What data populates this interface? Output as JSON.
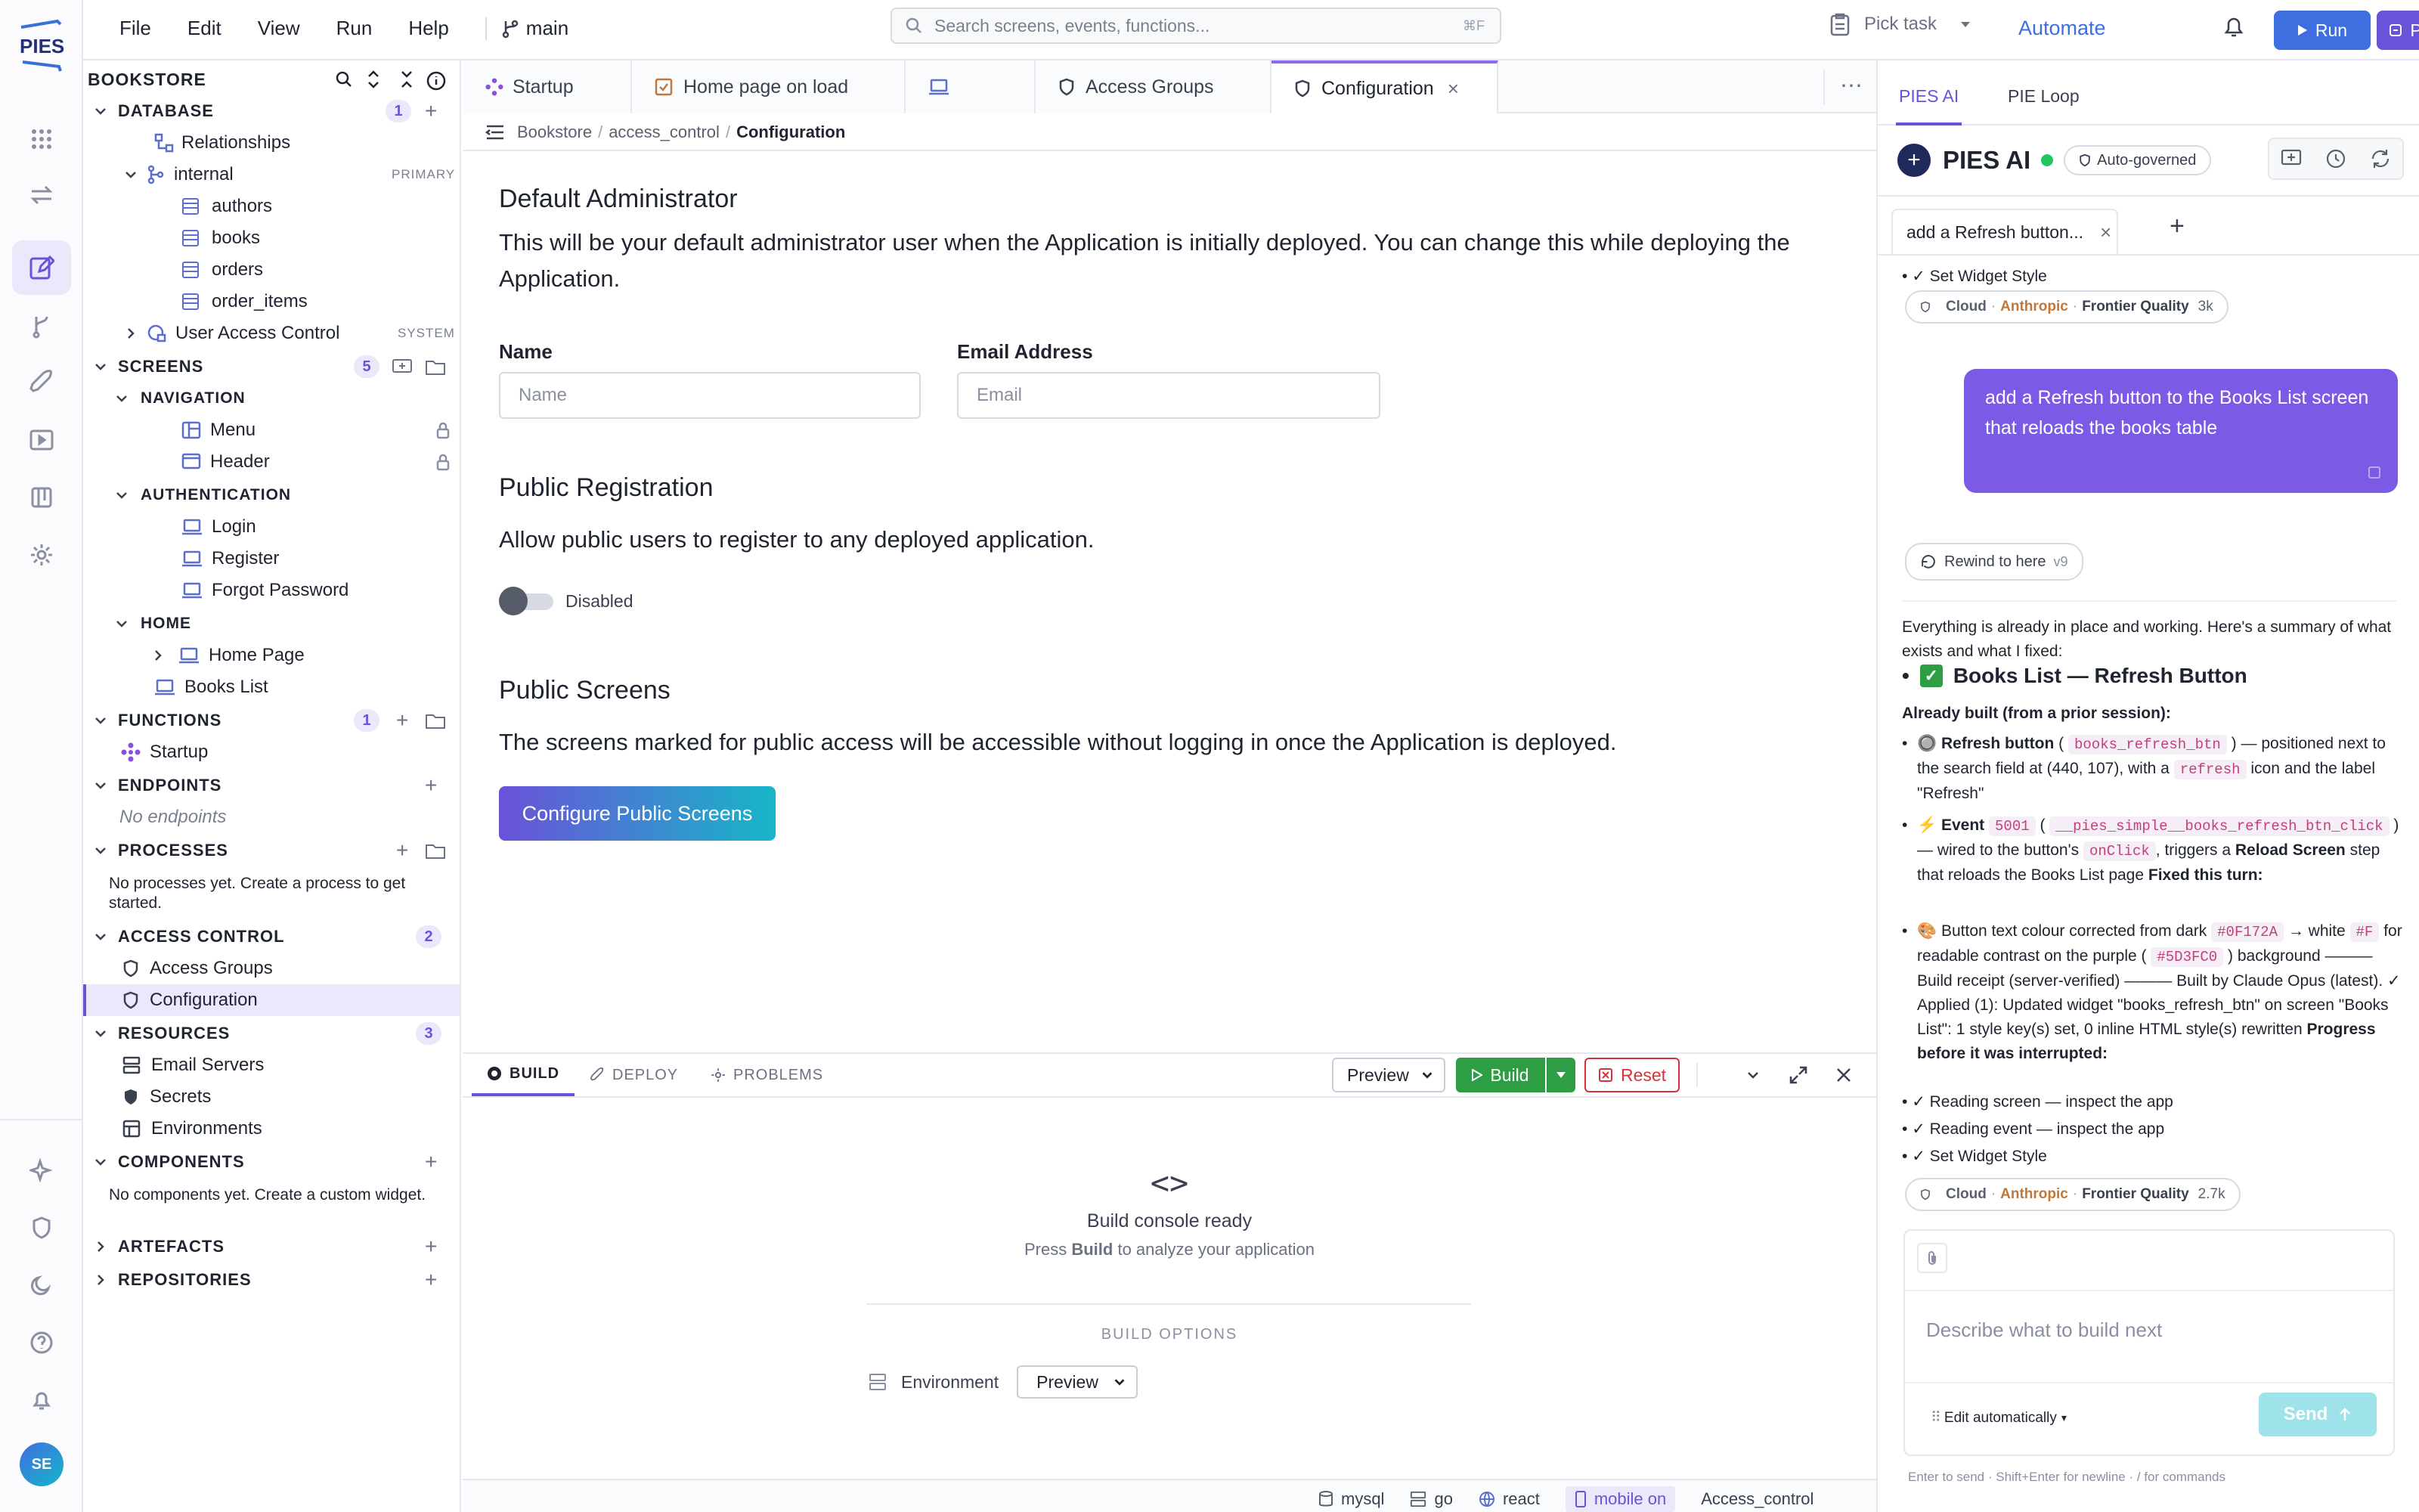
{
  "app": {
    "logo_text": "PIES",
    "user_initials": "SE"
  },
  "menu": [
    "File",
    "Edit",
    "View",
    "Run",
    "Help"
  ],
  "branch": "main",
  "search": {
    "placeholder": "Search screens, events, functions...",
    "shortcut": "⌘F"
  },
  "top_actions": {
    "pick_task": "Pick task",
    "automate": "Automate",
    "run": "Run",
    "pies_ai": "PIES AI"
  },
  "sidebar": {
    "title": "BOOKSTORE",
    "database": {
      "label": "DATABASE",
      "count": "1",
      "relationships": "Relationships",
      "internal": "internal",
      "internal_meta": "PRIMARY",
      "tables": [
        "authors",
        "books",
        "orders",
        "order_items"
      ],
      "uac": "User Access Control",
      "uac_meta": "SYSTEM"
    },
    "screens": {
      "label": "SCREENS",
      "count": "5",
      "navigation": "NAVIGATION",
      "nav_items": [
        "Menu",
        "Header"
      ],
      "authentication": "AUTHENTICATION",
      "auth_items": [
        "Login",
        "Register",
        "Forgot Password"
      ],
      "home": "HOME",
      "home_page": "Home Page",
      "books_list": "Books List"
    },
    "functions": {
      "label": "FUNCTIONS",
      "count": "1",
      "startup": "Startup"
    },
    "endpoints": {
      "label": "ENDPOINTS",
      "empty": "No endpoints"
    },
    "processes": {
      "label": "PROCESSES",
      "empty": "No processes yet. Create a process to get started."
    },
    "access_control": {
      "label": "ACCESS CONTROL",
      "count": "2",
      "items": [
        "Access Groups",
        "Configuration"
      ]
    },
    "resources": {
      "label": "RESOURCES",
      "count": "3",
      "items": [
        "Email Servers",
        "Secrets",
        "Environments"
      ]
    },
    "components": {
      "label": "COMPONENTS",
      "empty": "No components yet. Create a custom widget."
    },
    "artefacts": {
      "label": "ARTEFACTS"
    },
    "repositories": {
      "label": "REPOSITORIES"
    }
  },
  "tabs": [
    "Startup",
    "Home page on load",
    "",
    "Access Groups",
    "Configuration"
  ],
  "breadcrumb": [
    "Bookstore",
    "access_control",
    "Configuration"
  ],
  "form": {
    "admin_title": "Default Administrator",
    "admin_desc": "This will be your default administrator user when the Application is initially deployed. You can change this while deploying the Application.",
    "name_label": "Name",
    "name_placeholder": "Name",
    "email_label": "Email Address",
    "email_placeholder": "Email",
    "reg_title": "Public Registration",
    "reg_desc": "Allow public users to register to any deployed application.",
    "reg_toggle": "Disabled",
    "screens_title": "Public Screens",
    "screens_desc": "The screens marked for public access will be accessible without logging in once the Application is deployed.",
    "configure_btn": "Configure Public Screens"
  },
  "console": {
    "tabs": [
      "BUILD",
      "DEPLOY",
      "PROBLEMS"
    ],
    "env_select": "Preview",
    "build": "Build",
    "reset": "Reset",
    "ready": "Build console ready",
    "hint_prefix": "Press ",
    "hint_bold": "Build",
    "hint_suffix": " to analyze your application",
    "options": "BUILD OPTIONS",
    "env_label": "Environment",
    "env_value": "Preview"
  },
  "status": [
    "mysql",
    "go",
    "react",
    "mobile on",
    "Access_control"
  ],
  "right": {
    "tabs": [
      "PIES AI",
      "PIE Loop"
    ],
    "title": "PIES AI",
    "governed": "Auto-governed",
    "chat_tab": "add a Refresh button...",
    "top_item": "✓ Set Widget Style",
    "model_chip": {
      "cloud": "Cloud",
      "vendor": "Anthropic",
      "quality": "Frontier Quality",
      "tokens": "3k"
    },
    "user_msg": "add a Refresh button to the Books List screen that reloads the books table",
    "rewind": "Rewind to here",
    "rewind_ver": "v9",
    "intro": "Everything is already in place and working. Here's a summary of what exists and what I fixed:",
    "heading": "Books List — Refresh Button",
    "already": "Already built (from a prior session):",
    "b1_title": "Refresh button",
    "b1_code": "books_refresh_btn",
    "b1_text": "— positioned next to the search field at (440, 107), with a",
    "b1_code2": "refresh",
    "b1_tail": "icon and the label \"Refresh\"",
    "b2_title": "Event",
    "b2_code": "5001",
    "b2_code2": "__pies_simple__books_refresh_btn_click",
    "b2_text": "— wired to the button's",
    "b2_code3": "onClick",
    "b2_text2": ", triggers a",
    "b2_bold": "Reload Screen",
    "b2_text3": "step that reloads the Books List page",
    "b2_bold2": "Fixed this turn:",
    "b3_text": "Button text colour corrected from dark",
    "b3_code": "#0F172A",
    "b3_text2": "→ white",
    "b3_code2": "#F",
    "b3_text3": "for readable contrast on the purple (",
    "b3_code3": "#5D3FC0",
    "b3_text4": ") background ——— Build receipt (server-verified) ——— Built by Claude Opus (latest). ✓ Applied (1): Updated widget \"books_refresh_btn\" on screen \"Books List\": 1 style key(s) set, 0 inline HTML style(s) rewritten",
    "b3_bold": "Progress before it was interrupted:",
    "checks": [
      "✓ Reading screen — inspect the app",
      "✓ Reading event — inspect the app",
      "✓ Set Widget Style"
    ],
    "model_chip2": {
      "cloud": "Cloud",
      "vendor": "Anthropic",
      "quality": "Frontier Quality",
      "tokens": "2.7k"
    },
    "input_placeholder": "Describe what to build next",
    "edit_mode": "Edit automatically",
    "send": "Send",
    "footer": "Enter to send · Shift+Enter for newline · / for commands"
  },
  "colors": {
    "accent": "#6a52d9",
    "teal": "#17b6c8",
    "run": "#3d6fe0",
    "build": "#2e9e44",
    "reset": "#d4333b"
  }
}
